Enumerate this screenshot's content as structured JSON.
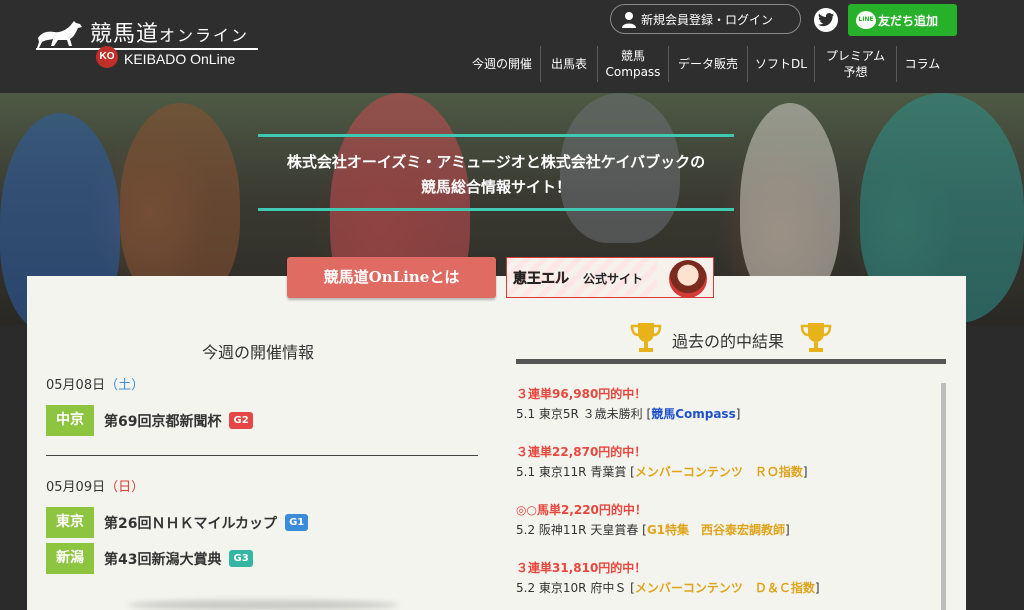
{
  "header": {
    "logo_jp": "競馬道",
    "logo_jp_sub": "オンライン",
    "logo_badge": "KO",
    "logo_en": "KEIBADO OnLine",
    "login_label": "新規会員登録・ログイン",
    "line_label": "友だち追加",
    "line_icon_text": "LINE"
  },
  "nav": [
    {
      "label": "今週の開催"
    },
    {
      "label": "出馬表"
    },
    {
      "label": "競馬\nCompass"
    },
    {
      "label": "データ販売"
    },
    {
      "label": "ソフトDL"
    },
    {
      "label": "プレミアム\n予想"
    },
    {
      "label": "コラム"
    }
  ],
  "hero": {
    "line1": "株式会社オーイズミ・アミュージオと株式会社ケイバブックの",
    "line2": "競馬総合情報サイト！"
  },
  "about_button": "競馬道OnLineとは",
  "ele_banner": {
    "logo": "恵王エル",
    "label": "公式サイト"
  },
  "schedule": {
    "title": "今週の開催情報",
    "days": [
      {
        "date": "05月08日",
        "dow": "（土）",
        "races": [
          {
            "venue": "中京",
            "name": "第69回京都新聞杯",
            "grade": "G2"
          }
        ]
      },
      {
        "date": "05月09日",
        "dow": "（日）",
        "races": [
          {
            "venue": "東京",
            "name": "第26回ＮＨＫマイルカップ",
            "grade": "G1"
          },
          {
            "venue": "新潟",
            "name": "第43回新潟大賞典",
            "grade": "G3"
          }
        ]
      }
    ]
  },
  "results": {
    "title": "過去の的中結果",
    "items": [
      {
        "hit": "３連単96,980円的中！",
        "detail": "5.1 東京5R ３歳未勝利 [",
        "tag": "競馬Compass",
        "tag_style": "blue",
        "end": "]"
      },
      {
        "hit": "３連単22,870円的中！",
        "detail": "5.1 東京11R 青葉賞 [",
        "tag": "メンバーコンテンツ　ＲＯ指数",
        "tag_style": "gold",
        "end": "]"
      },
      {
        "hit": "◎○馬単2,220円的中！",
        "detail": "5.2 阪神11R 天皇賞春 [",
        "tag": "G1特集　西谷泰宏調教師",
        "tag_style": "gold",
        "end": "]"
      },
      {
        "hit": "３連単31,810円的中！",
        "detail": "5.2 東京10R 府中Ｓ [",
        "tag": "メンバーコンテンツ　Ｄ＆Ｃ指数",
        "tag_style": "gold",
        "end": "]"
      }
    ]
  },
  "colors": {
    "accent_teal": "#3fc9b3",
    "venue_green": "#8dc540",
    "hit_red": "#e8473e",
    "link_blue": "#1e51c9",
    "link_gold": "#e0a41b",
    "line_green": "#27b12a"
  },
  "icons": [
    "horse-icon",
    "user-icon",
    "twitter-icon",
    "line-icon",
    "trophy-icon"
  ]
}
